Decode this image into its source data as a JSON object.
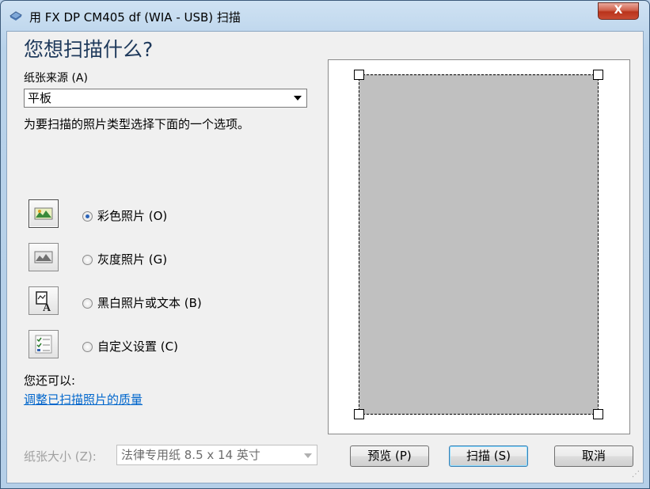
{
  "window": {
    "title": "用 FX DP CM405 df (WIA - USB) 扫描",
    "close_label": "X"
  },
  "main": {
    "heading": "您想扫描什么?",
    "paper_source_label": "纸张来源 (A)",
    "paper_source_value": "平板",
    "instruction": "为要扫描的照片类型选择下面的一个选项。",
    "options": [
      {
        "label": "彩色照片 (O)",
        "icon": "color-photo-icon",
        "checked": true
      },
      {
        "label": "灰度照片 (G)",
        "icon": "grayscale-photo-icon",
        "checked": false
      },
      {
        "label": "黑白照片或文本 (B)",
        "icon": "bw-text-icon",
        "checked": false
      },
      {
        "label": "自定义设置 (C)",
        "icon": "custom-settings-icon",
        "checked": false
      }
    ],
    "also_label": "您还可以:",
    "quality_link": "调整已扫描照片的质量",
    "paper_size_label": "纸张大小 (Z):",
    "paper_size_value": "法律专用纸 8.5 x 14 英寸"
  },
  "buttons": {
    "preview": "预览 (P)",
    "scan": "扫描 (S)",
    "cancel": "取消"
  },
  "colors": {
    "heading": "#1e395b",
    "link": "#0066cc",
    "preview_area": "#c0c0c0"
  }
}
